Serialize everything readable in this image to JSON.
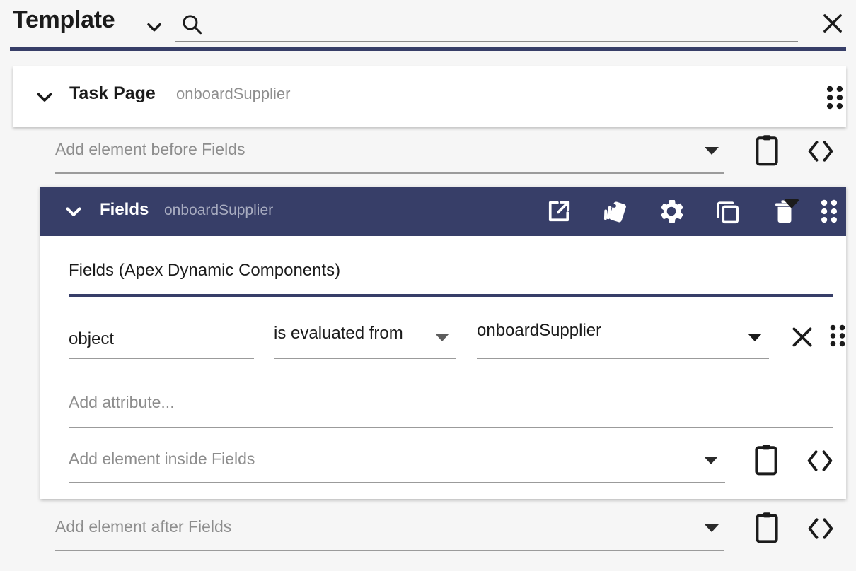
{
  "topbar": {
    "title": "Template",
    "caret_icon": "chevron-down-icon",
    "search_icon": "search-icon",
    "search_value": "",
    "search_placeholder": "",
    "close_icon": "close-icon",
    "accent_color": "#373e68"
  },
  "task_page": {
    "caret_icon": "chevron-down-icon",
    "title": "Task Page",
    "subtitle": "onboardSupplier",
    "drag_icon": "drag-handle-icon"
  },
  "rows": {
    "before": {
      "placeholder": "Add element before Fields",
      "paste_icon": "clipboard-paste-icon",
      "code_icon": "code-brackets-icon"
    },
    "inside": {
      "placeholder": "Add element inside Fields",
      "paste_icon": "clipboard-paste-icon",
      "code_icon": "code-brackets-icon"
    },
    "after": {
      "placeholder": "Add element after Fields",
      "paste_icon": "clipboard-paste-icon",
      "code_icon": "code-brackets-icon"
    }
  },
  "fields": {
    "header": {
      "caret_icon": "chevron-down-icon",
      "title": "Fields",
      "subtitle": "onboardSupplier",
      "background_color": "#373e68",
      "icons": [
        {
          "name": "open-external-icon",
          "label": "Open"
        },
        {
          "name": "style-cards-icon",
          "label": "Style"
        },
        {
          "name": "gear-icon",
          "label": "Settings"
        },
        {
          "name": "copy-icon",
          "label": "Duplicate"
        },
        {
          "name": "trash-icon",
          "label": "Delete"
        },
        {
          "name": "drag-handle-icon",
          "label": "Drag"
        }
      ]
    },
    "type_select": {
      "value": "Fields (Apex Dynamic Components)",
      "underline_color": "#373e68"
    },
    "attribute": {
      "name": "object",
      "operator": "is evaluated from",
      "value": "onboardSupplier",
      "remove_icon": "close-icon",
      "drag_icon": "drag-handle-icon"
    },
    "add_attribute_placeholder": "Add attribute..."
  }
}
